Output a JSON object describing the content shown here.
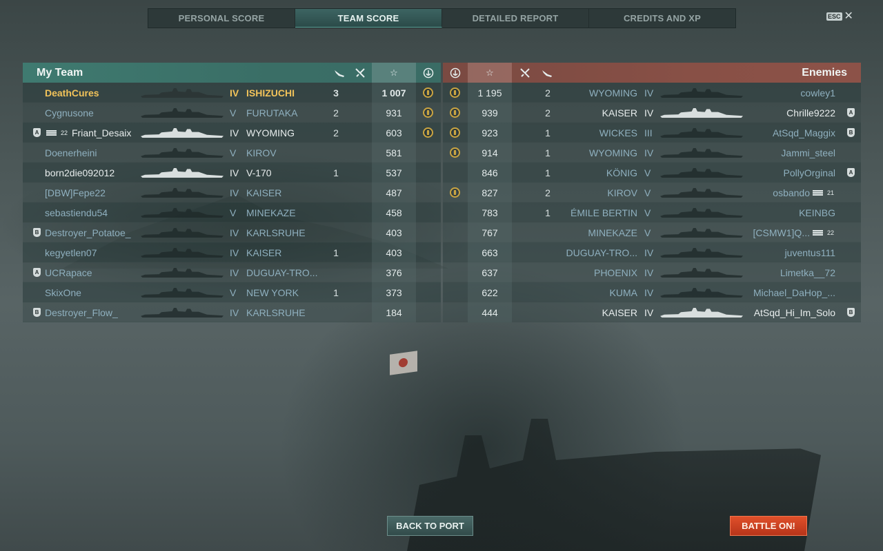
{
  "tabs": [
    {
      "label": "PERSONAL SCORE",
      "active": false
    },
    {
      "label": "TEAM SCORE",
      "active": true
    },
    {
      "label": "DETAILED REPORT",
      "active": false
    },
    {
      "label": "CREDITS AND XP",
      "active": false
    }
  ],
  "esc": {
    "key_label": "ESC",
    "close_glyph": "✕"
  },
  "my_team": {
    "title": "My Team",
    "columns": {
      "planes_icon": "plane-icon",
      "kills_icon": "kills-icon",
      "score_icon": "☆",
      "medal_icon": "anchor-medal-icon"
    },
    "rows": [
      {
        "player": "DeathCures",
        "tier": "IV",
        "ship": "ISHIZUCHI",
        "kills": "3",
        "score": "1 007",
        "medal": true,
        "division": "",
        "clan_flag": "",
        "alive": true,
        "me": true
      },
      {
        "player": "Cygnusone",
        "tier": "V",
        "ship": "FURUTAKA",
        "kills": "2",
        "score": "931",
        "medal": true,
        "division": "",
        "clan_flag": "",
        "alive": false,
        "me": false
      },
      {
        "player": "Friant_Desaix",
        "tier": "IV",
        "ship": "WYOMING",
        "kills": "2",
        "score": "603",
        "medal": true,
        "division": "A",
        "clan_flag": "22",
        "alive": true,
        "me": false
      },
      {
        "player": "Doenerheini",
        "tier": "V",
        "ship": "KIROV",
        "kills": "",
        "score": "581",
        "medal": false,
        "division": "",
        "clan_flag": "",
        "alive": false,
        "me": false
      },
      {
        "player": "born2die092012",
        "tier": "IV",
        "ship": "V-170",
        "kills": "1",
        "score": "537",
        "medal": false,
        "division": "",
        "clan_flag": "",
        "alive": true,
        "me": false
      },
      {
        "player": "[DBW]Fepe22",
        "tier": "IV",
        "ship": "KAISER",
        "kills": "",
        "score": "487",
        "medal": false,
        "division": "",
        "clan_flag": "",
        "alive": false,
        "me": false
      },
      {
        "player": "sebastiendu54",
        "tier": "V",
        "ship": "MINEKAZE",
        "kills": "",
        "score": "458",
        "medal": false,
        "division": "",
        "clan_flag": "",
        "alive": false,
        "me": false
      },
      {
        "player": "Destroyer_Potatoe_",
        "tier": "IV",
        "ship": "KARLSRUHE",
        "kills": "",
        "score": "403",
        "medal": false,
        "division": "B",
        "clan_flag": "",
        "alive": false,
        "me": false
      },
      {
        "player": "kegyetlen07",
        "tier": "IV",
        "ship": "KAISER",
        "kills": "1",
        "score": "403",
        "medal": false,
        "division": "",
        "clan_flag": "",
        "alive": false,
        "me": false
      },
      {
        "player": "UCRapace",
        "tier": "IV",
        "ship": "DUGUAY-TRO...",
        "kills": "",
        "score": "376",
        "medal": false,
        "division": "A",
        "clan_flag": "",
        "alive": false,
        "me": false
      },
      {
        "player": "SkixOne",
        "tier": "V",
        "ship": "NEW YORK",
        "kills": "1",
        "score": "373",
        "medal": false,
        "division": "",
        "clan_flag": "",
        "alive": false,
        "me": false
      },
      {
        "player": "Destroyer_Flow_",
        "tier": "IV",
        "ship": "KARLSRUHE",
        "kills": "",
        "score": "184",
        "medal": false,
        "division": "B",
        "clan_flag": "",
        "alive": false,
        "me": false
      }
    ]
  },
  "enemies": {
    "title": "Enemies",
    "rows": [
      {
        "player": "cowley1",
        "tier": "IV",
        "ship": "WYOMING",
        "kills": "2",
        "score": "1 195",
        "medal": true,
        "division": "",
        "clan_flag": "",
        "alive": false
      },
      {
        "player": "Chrille9222",
        "tier": "IV",
        "ship": "KAISER",
        "kills": "2",
        "score": "939",
        "medal": true,
        "division": "A",
        "clan_flag": "",
        "alive": true
      },
      {
        "player": "AtSqd_Maggix",
        "tier": "III",
        "ship": "WICKES",
        "kills": "1",
        "score": "923",
        "medal": true,
        "division": "B",
        "clan_flag": "",
        "alive": false
      },
      {
        "player": "Jammi_steel",
        "tier": "IV",
        "ship": "WYOMING",
        "kills": "1",
        "score": "914",
        "medal": true,
        "division": "",
        "clan_flag": "",
        "alive": false
      },
      {
        "player": "PollyOrginal",
        "tier": "V",
        "ship": "KÖNIG",
        "kills": "1",
        "score": "846",
        "medal": false,
        "division": "A",
        "clan_flag": "",
        "alive": false
      },
      {
        "player": "osbando",
        "tier": "V",
        "ship": "KIROV",
        "kills": "2",
        "score": "827",
        "medal": true,
        "division": "",
        "clan_flag": "21",
        "alive": false
      },
      {
        "player": "KEINBG",
        "tier": "V",
        "ship": "ÉMILE BERTIN",
        "kills": "1",
        "score": "783",
        "medal": false,
        "division": "",
        "clan_flag": "",
        "alive": false
      },
      {
        "player": "[CSMW1]Q...",
        "tier": "V",
        "ship": "MINEKAZE",
        "kills": "",
        "score": "767",
        "medal": false,
        "division": "",
        "clan_flag": "22",
        "alive": false
      },
      {
        "player": "juventus111",
        "tier": "IV",
        "ship": "DUGUAY-TRO...",
        "kills": "",
        "score": "663",
        "medal": false,
        "division": "",
        "clan_flag": "",
        "alive": false
      },
      {
        "player": "Limetka__72",
        "tier": "IV",
        "ship": "PHOENIX",
        "kills": "",
        "score": "637",
        "medal": false,
        "division": "",
        "clan_flag": "",
        "alive": false
      },
      {
        "player": "Michael_DaHop_...",
        "tier": "IV",
        "ship": "KUMA",
        "kills": "",
        "score": "622",
        "medal": false,
        "division": "",
        "clan_flag": "",
        "alive": false
      },
      {
        "player": "AtSqd_Hi_Im_Solo",
        "tier": "IV",
        "ship": "KAISER",
        "kills": "",
        "score": "444",
        "medal": false,
        "division": "B",
        "clan_flag": "",
        "alive": true
      }
    ]
  },
  "buttons": {
    "back": "BACK TO PORT",
    "battle": "BATTLE ON!"
  },
  "colors": {
    "my_team_header": "#3f7a70",
    "enemies_header": "#885046",
    "me_highlight": "#f2c35a",
    "battle_button": "#d0441f"
  }
}
